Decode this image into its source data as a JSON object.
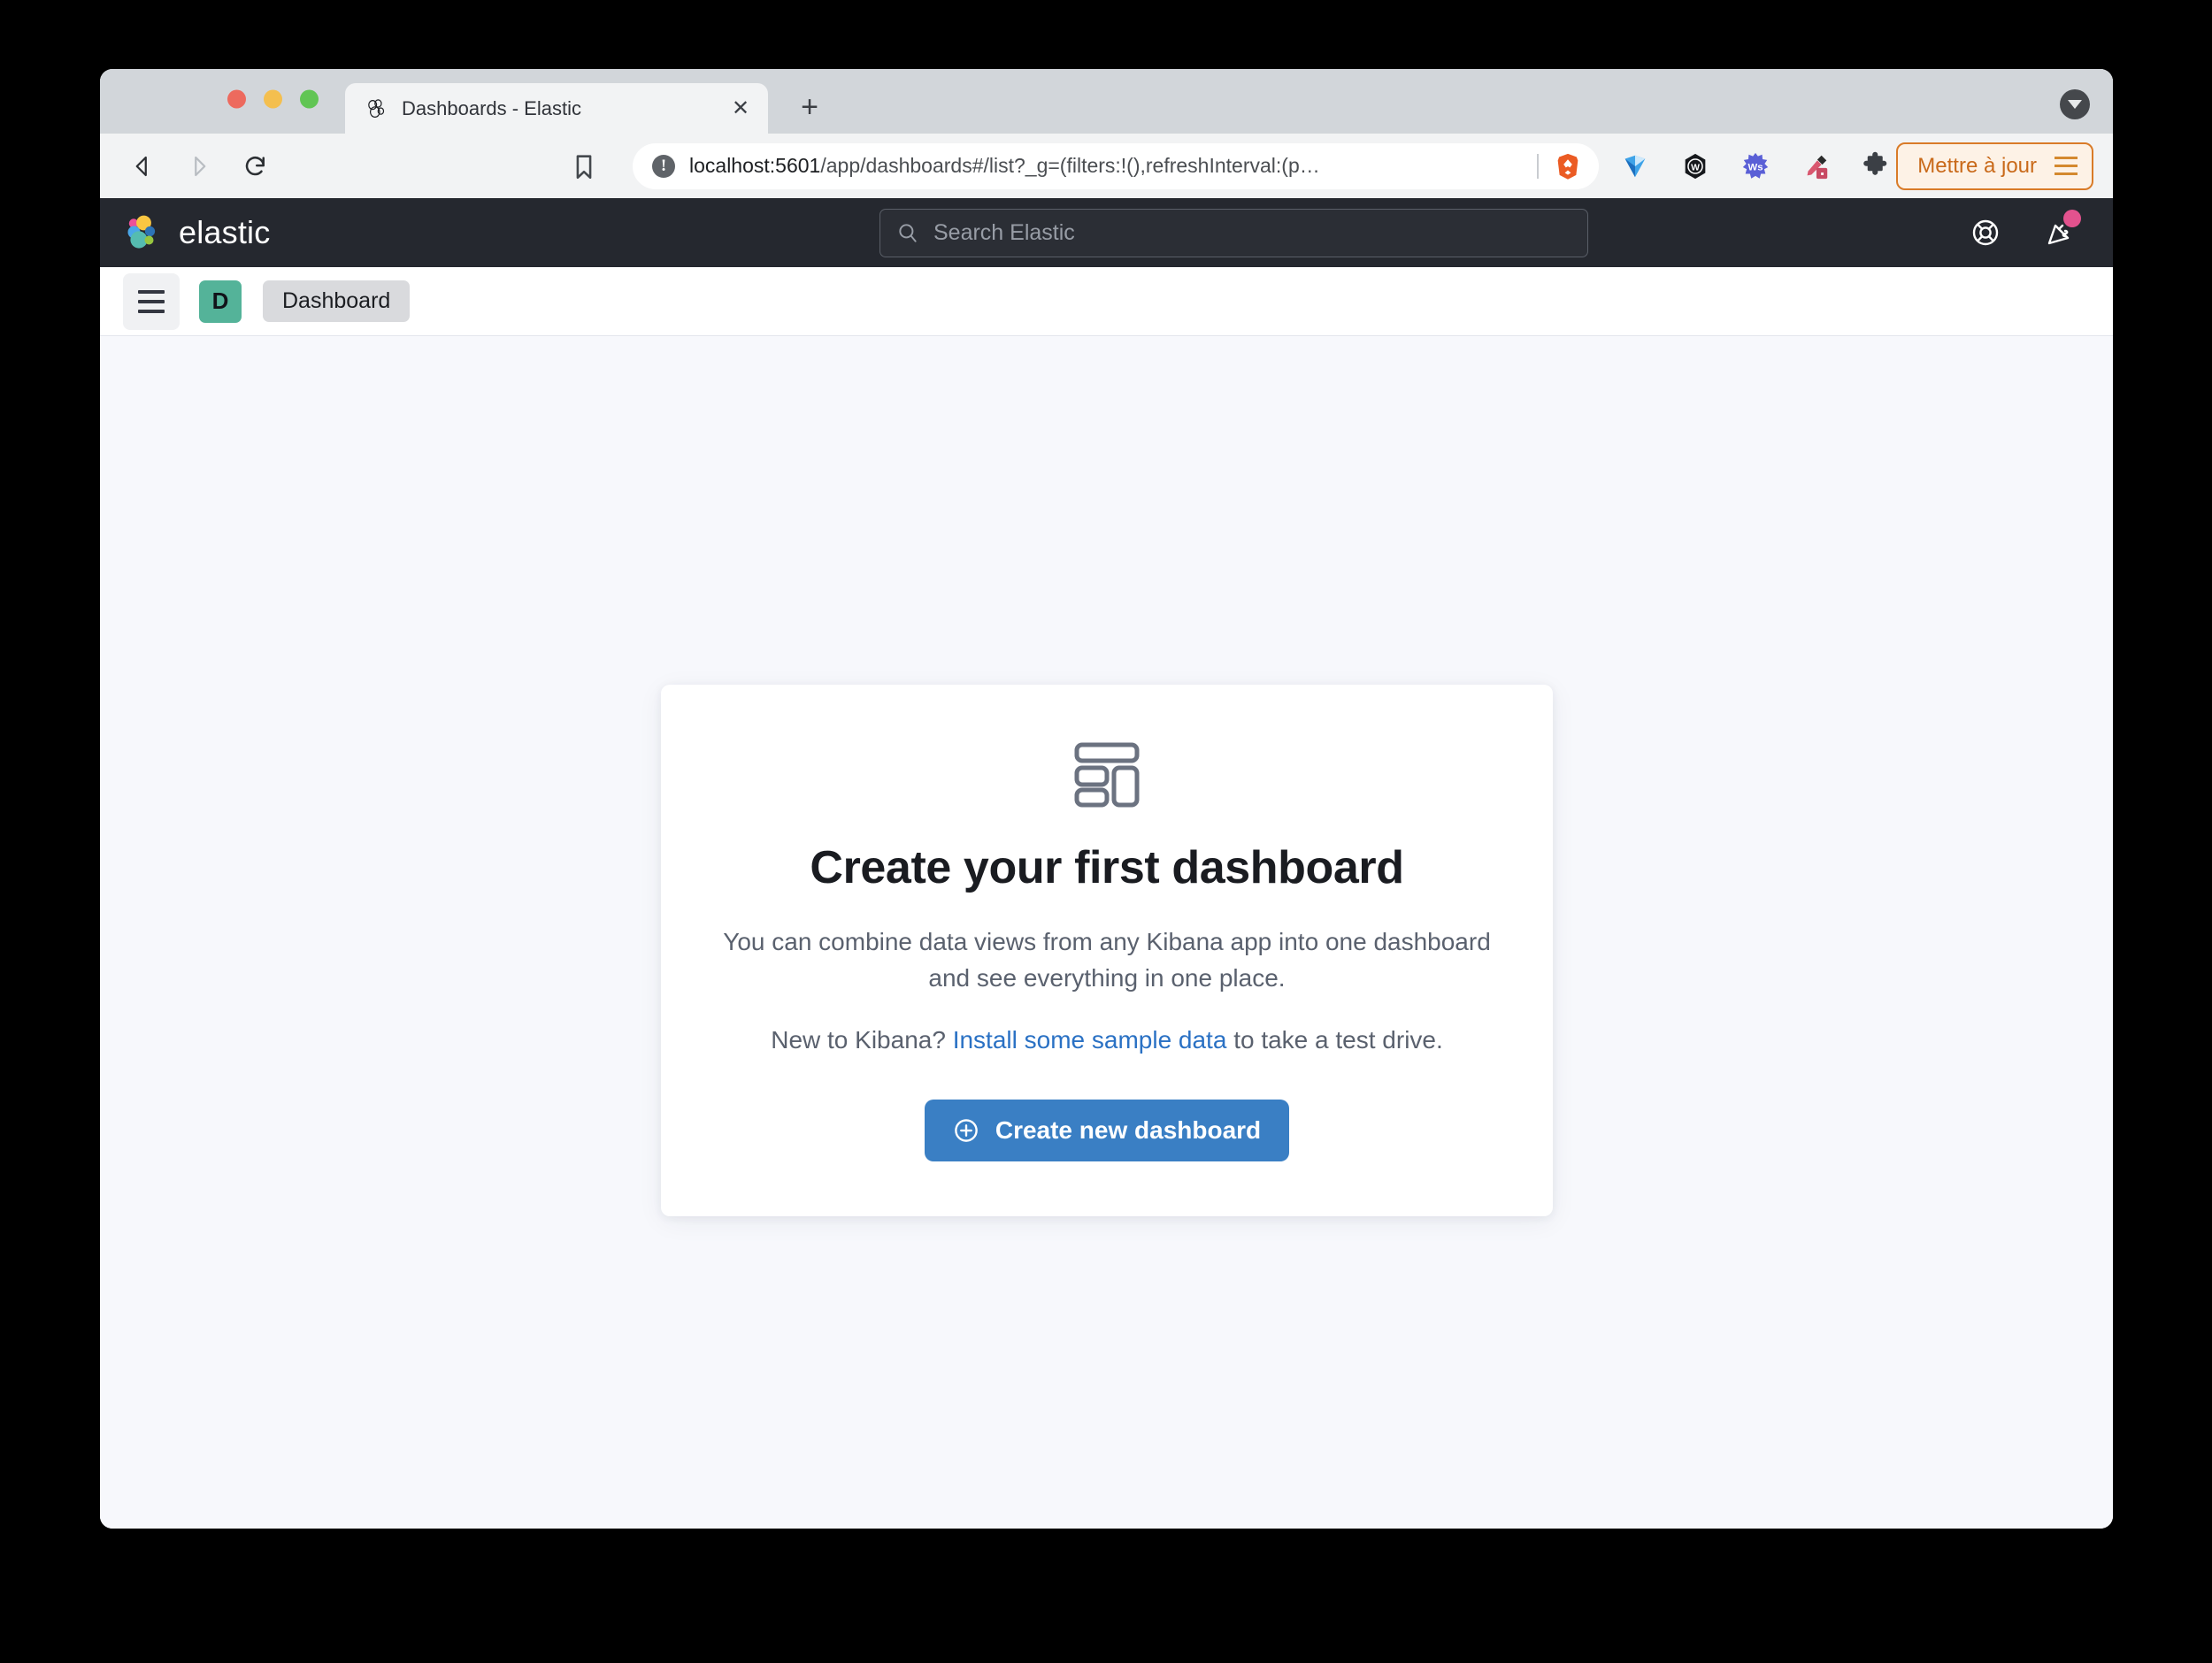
{
  "browser": {
    "tab": {
      "title": "Dashboards - Elastic",
      "favicon_icon": "elastic-logo-icon",
      "close_icon": "close-icon",
      "close_label": "✕"
    },
    "new_tab_label": "+",
    "new_tab_icon": "plus-icon",
    "tabstrip_menu_icon": "chevron-down-icon",
    "nav": {
      "back_icon": "back-arrow-icon",
      "forward_icon": "forward-arrow-icon",
      "reload_icon": "reload-icon",
      "bookmark_icon": "bookmark-icon"
    },
    "omnibox": {
      "security_icon": "info-circle-icon",
      "security_glyph": "!",
      "url_host": "localhost:5601",
      "url_path": "/app/dashboards#/list?_g=(filters:!(),refreshInterval:(p…",
      "brave_icon": "brave-shields-icon"
    },
    "extensions": [
      {
        "name": "grammarly-icon",
        "glyph": "▼"
      },
      {
        "name": "wappalyzer-icon",
        "glyph": "W"
      },
      {
        "name": "wordstream-icon",
        "glyph": "Ws"
      },
      {
        "name": "colorpicker-icon",
        "glyph": "✒"
      },
      {
        "name": "extensions-puzzle-icon",
        "glyph": "⬟"
      }
    ],
    "update_button": {
      "label": "Mettre à jour",
      "menu_icon": "hamburger-icon"
    }
  },
  "elastic_header": {
    "logo_icon": "elastic-cluster-logo-icon",
    "wordmark": "elastic",
    "search": {
      "placeholder": "Search Elastic",
      "icon": "search-icon",
      "value": ""
    },
    "actions": [
      {
        "name": "help-icon",
        "label": "Help"
      },
      {
        "name": "news-feed-icon",
        "label": "News",
        "badge": true
      }
    ]
  },
  "breadcrumb_bar": {
    "menu_icon": "hamburger-menu-icon",
    "app_badge": "D",
    "crumb": "Dashboard"
  },
  "empty_state": {
    "icon": "dashboard-layout-icon",
    "title": "Create your first dashboard",
    "description": "You can combine data views from any Kibana app into one dashboard and see everything in one place.",
    "cta_prefix": "New to Kibana? ",
    "cta_link": "Install some sample data",
    "cta_suffix": " to take a test drive.",
    "button": {
      "label": "Create new dashboard",
      "icon": "plus-circle-icon"
    }
  },
  "colors": {
    "accent_blue": "#3a7fc4",
    "link_blue": "#2a71c4",
    "app_badge_green": "#54b399",
    "header_dark": "#25282f",
    "update_orange": "#c96a1a",
    "notification_pink": "#e3528e"
  }
}
